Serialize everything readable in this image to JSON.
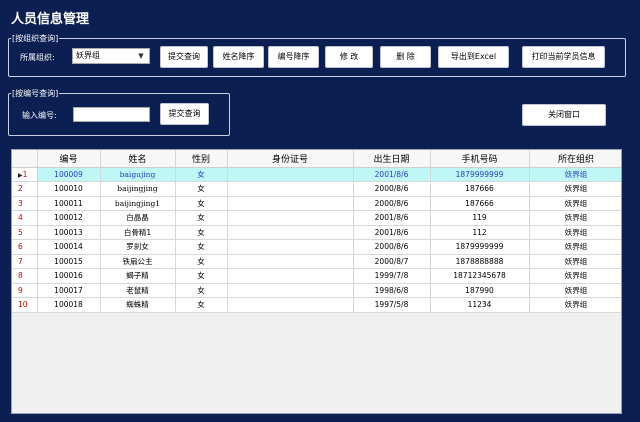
{
  "app": {
    "title": "人员信息管理"
  },
  "group_org": {
    "legend": "[按组织查询]",
    "label": "所属组织:",
    "selected": "妖界组",
    "buttons": {
      "submit": "提交查询",
      "name_desc": "姓名降序",
      "id_desc": "编号降序",
      "edit": "修 改",
      "delete": "删 除",
      "export": "导出到Excel",
      "print": "打印当前学员信息"
    }
  },
  "group_id": {
    "legend": "[按编号查询]",
    "label": "输入编号:",
    "value": "",
    "submit": "提交查询"
  },
  "close_button": "关闭窗口",
  "table": {
    "columns": [
      "编号",
      "姓名",
      "性别",
      "身份证号",
      "出生日期",
      "手机号码",
      "所在组织"
    ],
    "rows": [
      {
        "n": "1",
        "id": "100009",
        "name": "baigujing",
        "sex": "女",
        "idcard": "",
        "birth": "2001/8/6",
        "phone": "1879999999",
        "org": "妖界组"
      },
      {
        "n": "2",
        "id": "100010",
        "name": "baijingjing",
        "sex": "女",
        "idcard": "",
        "birth": "2000/8/6",
        "phone": "187666",
        "org": "妖界组"
      },
      {
        "n": "3",
        "id": "100011",
        "name": "baijingjing1",
        "sex": "女",
        "idcard": "",
        "birth": "2000/8/6",
        "phone": "187666",
        "org": "妖界组"
      },
      {
        "n": "4",
        "id": "100012",
        "name": "白晶晶",
        "sex": "女",
        "idcard": "",
        "birth": "2001/8/6",
        "phone": "119",
        "org": "妖界组"
      },
      {
        "n": "5",
        "id": "100013",
        "name": "白骨精1",
        "sex": "女",
        "idcard": "",
        "birth": "2001/8/6",
        "phone": "112",
        "org": "妖界组"
      },
      {
        "n": "6",
        "id": "100014",
        "name": "罗刹女",
        "sex": "女",
        "idcard": "",
        "birth": "2000/8/6",
        "phone": "1879999999",
        "org": "妖界组"
      },
      {
        "n": "7",
        "id": "100015",
        "name": "铁扇公主",
        "sex": "女",
        "idcard": "",
        "birth": "2000/8/7",
        "phone": "1878888888",
        "org": "妖界组"
      },
      {
        "n": "8",
        "id": "100016",
        "name": "蝎子精",
        "sex": "女",
        "idcard": "",
        "birth": "1999/7/8",
        "phone": "18712345678",
        "org": "妖界组"
      },
      {
        "n": "9",
        "id": "100017",
        "name": "老鼠精",
        "sex": "女",
        "idcard": "",
        "birth": "1998/6/8",
        "phone": "187990",
        "org": "妖界组"
      },
      {
        "n": "10",
        "id": "100018",
        "name": "蜘蛛精",
        "sex": "女",
        "idcard": "",
        "birth": "1997/5/8",
        "phone": "11234",
        "org": "妖界组"
      }
    ]
  },
  "colors": {
    "background": "#0b1f52",
    "selected_row": "#bff6f6",
    "row_number": "#d40000"
  }
}
